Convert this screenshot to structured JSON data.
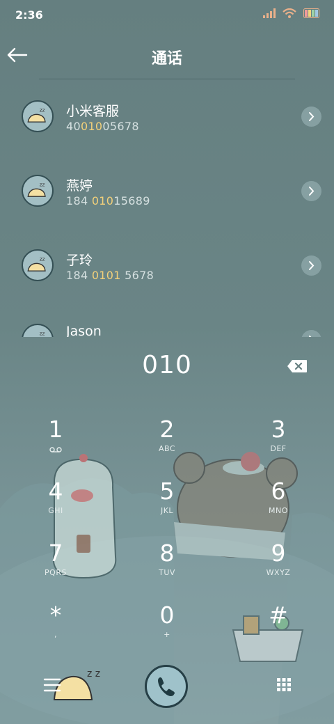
{
  "status_bar": {
    "time": "2:36"
  },
  "header": {
    "title": "通话"
  },
  "contacts": [
    {
      "name": "小米客服",
      "number": {
        "before": "40",
        "match": "010",
        "after": "05678"
      }
    },
    {
      "name": "燕婷",
      "number": {
        "before": "184 ",
        "match": "010",
        "after": "15689"
      }
    },
    {
      "name": "子玲",
      "number": {
        "before": "184 ",
        "match": "0101",
        "after": " 5678"
      }
    },
    {
      "name": "Jason",
      "number": {
        "before": "",
        "match": "",
        "after": ""
      }
    }
  ],
  "dialer": {
    "typed": "010",
    "keys": [
      {
        "digit": "1",
        "letters": ""
      },
      {
        "digit": "2",
        "letters": "ABC"
      },
      {
        "digit": "3",
        "letters": "DEF"
      },
      {
        "digit": "4",
        "letters": "GHI"
      },
      {
        "digit": "5",
        "letters": "JKL"
      },
      {
        "digit": "6",
        "letters": "MNO"
      },
      {
        "digit": "7",
        "letters": "PQRS"
      },
      {
        "digit": "8",
        "letters": "TUV"
      },
      {
        "digit": "9",
        "letters": "WXYZ"
      },
      {
        "digit": "*",
        "letters": ","
      },
      {
        "digit": "0",
        "letters": "+"
      },
      {
        "digit": "#",
        "letters": ""
      }
    ]
  },
  "colors": {
    "background": "#677f80",
    "highlight": "#f2d07a",
    "call_button": "#9fc2ca"
  }
}
